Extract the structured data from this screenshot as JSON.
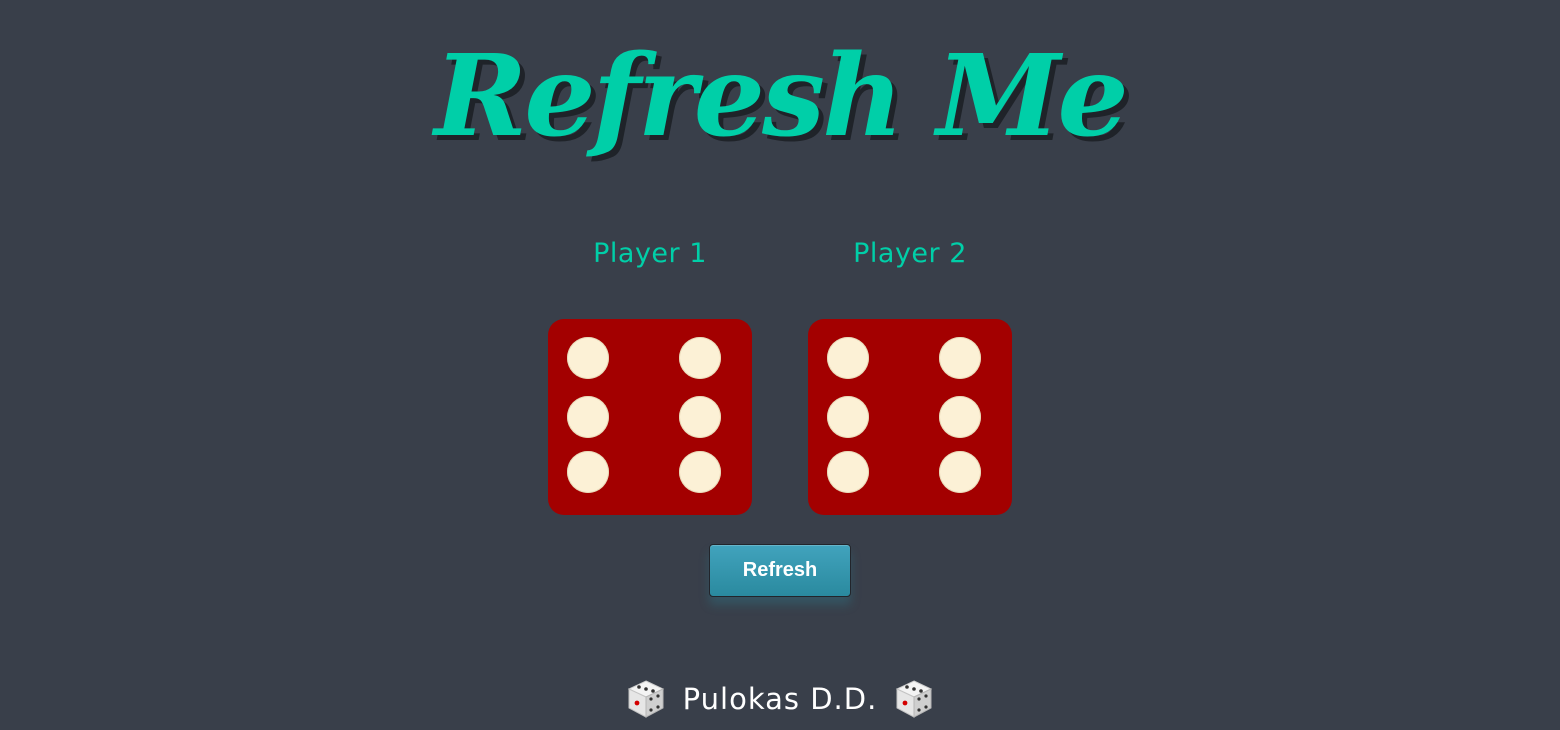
{
  "title": "Refresh Me",
  "players": [
    {
      "label": "Player 1",
      "die_value": 6
    },
    {
      "label": "Player 2",
      "die_value": 6
    }
  ],
  "refresh_button": {
    "label": "Refresh"
  },
  "footer": {
    "text": "Pulokas D.D.",
    "icons": [
      "dice-icon",
      "dice-icon"
    ]
  },
  "colors": {
    "background": "#393f4a",
    "accent": "#00cfa8",
    "die_face": "#a30000",
    "pip": "#fcf1d6",
    "button": "#3498ad"
  }
}
